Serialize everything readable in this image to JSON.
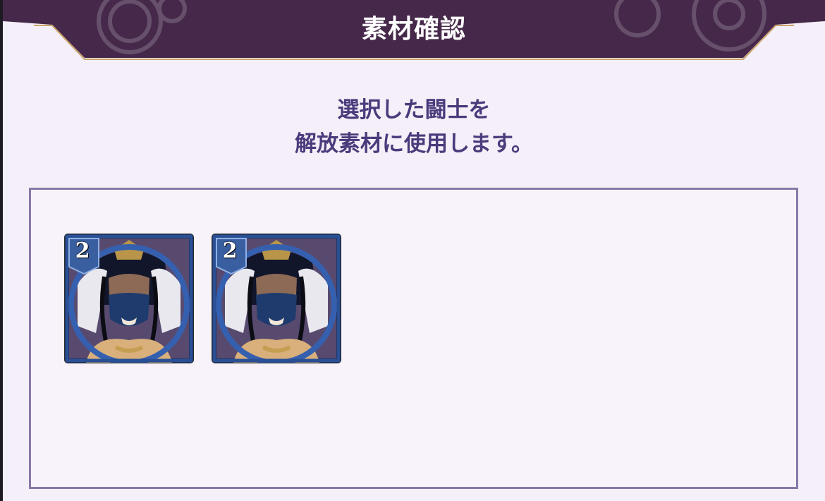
{
  "dialog": {
    "title": "素材確認",
    "message_line1": "選択した闘士を",
    "message_line2": "解放素材に使用します。"
  },
  "materials": [
    {
      "rank": "2",
      "character": "masked-turban-warrior-portrait"
    },
    {
      "rank": "2",
      "character": "masked-turban-warrior-portrait"
    }
  ],
  "colors": {
    "header_bg": "#46294a",
    "header_border": "#c9a26a",
    "dialog_bg": "#f4eff8",
    "text_primary": "#4a3b7c",
    "panel_border": "#8a78a8",
    "card_frame": "#2f5ba8"
  }
}
